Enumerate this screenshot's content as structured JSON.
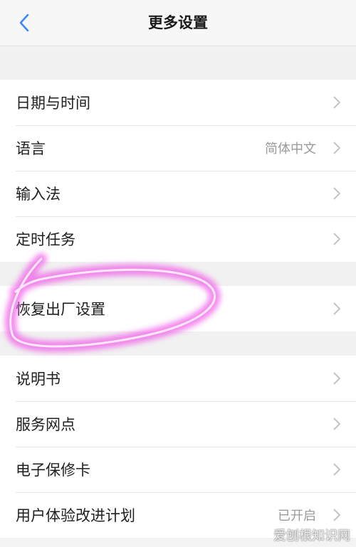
{
  "header": {
    "title": "更多设置",
    "back_icon": "chevron-left-icon",
    "accent": "#3a86ff"
  },
  "groups": [
    {
      "items": [
        {
          "label": "日期与时间",
          "value": ""
        },
        {
          "label": "语言",
          "value": "简体中文"
        },
        {
          "label": "输入法",
          "value": ""
        },
        {
          "label": "定时任务",
          "value": ""
        }
      ]
    },
    {
      "items": [
        {
          "label": "恢复出厂设置",
          "value": ""
        }
      ]
    },
    {
      "items": [
        {
          "label": "说明书",
          "value": ""
        },
        {
          "label": "服务网点",
          "value": ""
        },
        {
          "label": "电子保修卡",
          "value": ""
        },
        {
          "label": "用户体验改进计划",
          "value": "已开启"
        }
      ]
    }
  ],
  "watermark": "爱刨根知识网",
  "colors": {
    "background": "#f3f3f3",
    "row_background": "#ffffff",
    "secondary_text": "#9a9a9a",
    "highlight": "#f060e8"
  },
  "icons": {
    "row_chevron": "chevron-right-icon"
  }
}
